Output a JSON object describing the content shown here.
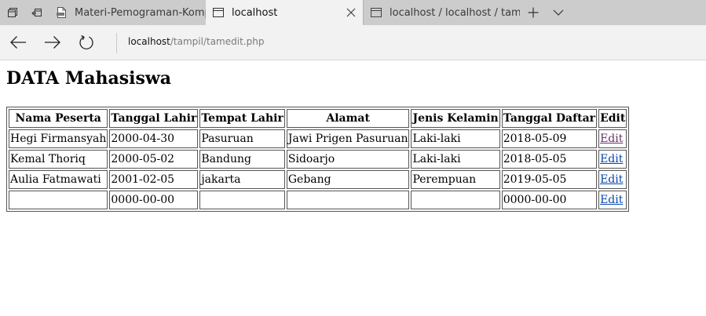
{
  "browser": {
    "tabs": [
      {
        "label": "Materi-Pemograman-Komp",
        "icon": "pdf-icon",
        "active": false
      },
      {
        "label": "localhost",
        "icon": "page-icon",
        "active": true
      },
      {
        "label": "localhost / localhost / tamp",
        "icon": "page-icon",
        "active": false
      }
    ],
    "address": {
      "host": "localhost",
      "path": "/tampil/tamedit.php"
    }
  },
  "page": {
    "title": "DATA Mahasiswa",
    "table": {
      "headers": [
        "Nama Peserta",
        "Tanggal Lahir",
        "Tempat Lahir",
        "Alamat",
        "Jenis Kelamin",
        "Tanggal Daftar",
        "Edit"
      ],
      "rows": [
        {
          "nama": "Hegi Firmansyah",
          "tgl_lahir": "2000-04-30",
          "tempat": "Pasuruan",
          "alamat": "Jawi Prigen Pasuruan",
          "jk": "Laki-laki",
          "tgl_daftar": "2018-05-09",
          "edit": "Edit"
        },
        {
          "nama": "Kemal Thoriq",
          "tgl_lahir": "2000-05-02",
          "tempat": "Bandung",
          "alamat": "Sidoarjo",
          "jk": "Laki-laki",
          "tgl_daftar": "2018-05-05",
          "edit": "Edit"
        },
        {
          "nama": "Aulia Fatmawati",
          "tgl_lahir": "2001-02-05",
          "tempat": "jakarta",
          "alamat": "Gebang",
          "jk": "Perempuan",
          "tgl_daftar": "2019-05-05",
          "edit": "Edit"
        },
        {
          "nama": "",
          "tgl_lahir": "0000-00-00",
          "tempat": "",
          "alamat": "",
          "jk": "",
          "tgl_daftar": "0000-00-00",
          "edit": "Edit"
        }
      ]
    }
  },
  "colors": {
    "link": "#0645ad",
    "visited_link": "#663366",
    "tabstrip_bg": "#cccccc",
    "active_tab_bg": "#f2f2f2"
  }
}
